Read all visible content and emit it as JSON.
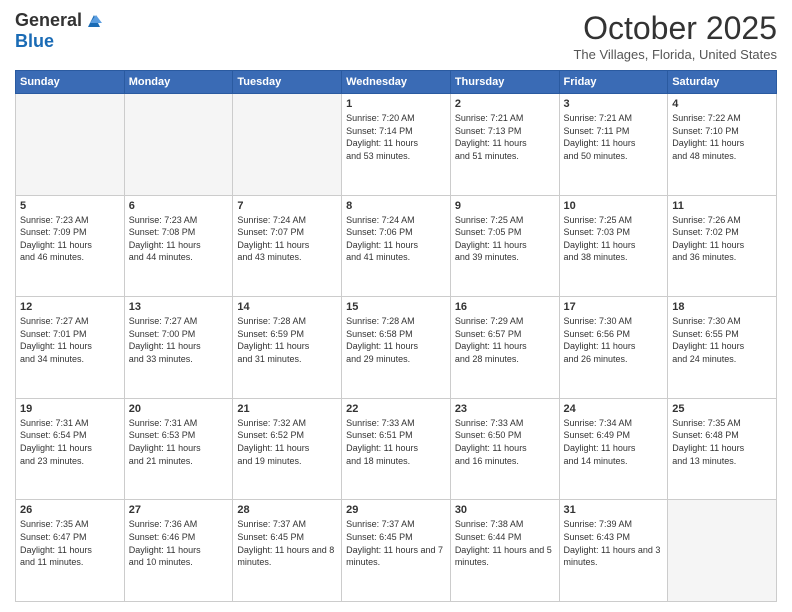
{
  "header": {
    "logo_general": "General",
    "logo_blue": "Blue",
    "month_title": "October 2025",
    "location": "The Villages, Florida, United States"
  },
  "weekdays": [
    "Sunday",
    "Monday",
    "Tuesday",
    "Wednesday",
    "Thursday",
    "Friday",
    "Saturday"
  ],
  "weeks": [
    [
      {
        "day": "",
        "empty": true
      },
      {
        "day": "",
        "empty": true
      },
      {
        "day": "",
        "empty": true
      },
      {
        "day": "1",
        "sunrise": "7:20 AM",
        "sunset": "7:14 PM",
        "daylight": "11 hours and 53 minutes."
      },
      {
        "day": "2",
        "sunrise": "7:21 AM",
        "sunset": "7:13 PM",
        "daylight": "11 hours and 51 minutes."
      },
      {
        "day": "3",
        "sunrise": "7:21 AM",
        "sunset": "7:11 PM",
        "daylight": "11 hours and 50 minutes."
      },
      {
        "day": "4",
        "sunrise": "7:22 AM",
        "sunset": "7:10 PM",
        "daylight": "11 hours and 48 minutes."
      }
    ],
    [
      {
        "day": "5",
        "sunrise": "7:23 AM",
        "sunset": "7:09 PM",
        "daylight": "11 hours and 46 minutes."
      },
      {
        "day": "6",
        "sunrise": "7:23 AM",
        "sunset": "7:08 PM",
        "daylight": "11 hours and 44 minutes."
      },
      {
        "day": "7",
        "sunrise": "7:24 AM",
        "sunset": "7:07 PM",
        "daylight": "11 hours and 43 minutes."
      },
      {
        "day": "8",
        "sunrise": "7:24 AM",
        "sunset": "7:06 PM",
        "daylight": "11 hours and 41 minutes."
      },
      {
        "day": "9",
        "sunrise": "7:25 AM",
        "sunset": "7:05 PM",
        "daylight": "11 hours and 39 minutes."
      },
      {
        "day": "10",
        "sunrise": "7:25 AM",
        "sunset": "7:03 PM",
        "daylight": "11 hours and 38 minutes."
      },
      {
        "day": "11",
        "sunrise": "7:26 AM",
        "sunset": "7:02 PM",
        "daylight": "11 hours and 36 minutes."
      }
    ],
    [
      {
        "day": "12",
        "sunrise": "7:27 AM",
        "sunset": "7:01 PM",
        "daylight": "11 hours and 34 minutes."
      },
      {
        "day": "13",
        "sunrise": "7:27 AM",
        "sunset": "7:00 PM",
        "daylight": "11 hours and 33 minutes."
      },
      {
        "day": "14",
        "sunrise": "7:28 AM",
        "sunset": "6:59 PM",
        "daylight": "11 hours and 31 minutes."
      },
      {
        "day": "15",
        "sunrise": "7:28 AM",
        "sunset": "6:58 PM",
        "daylight": "11 hours and 29 minutes."
      },
      {
        "day": "16",
        "sunrise": "7:29 AM",
        "sunset": "6:57 PM",
        "daylight": "11 hours and 28 minutes."
      },
      {
        "day": "17",
        "sunrise": "7:30 AM",
        "sunset": "6:56 PM",
        "daylight": "11 hours and 26 minutes."
      },
      {
        "day": "18",
        "sunrise": "7:30 AM",
        "sunset": "6:55 PM",
        "daylight": "11 hours and 24 minutes."
      }
    ],
    [
      {
        "day": "19",
        "sunrise": "7:31 AM",
        "sunset": "6:54 PM",
        "daylight": "11 hours and 23 minutes."
      },
      {
        "day": "20",
        "sunrise": "7:31 AM",
        "sunset": "6:53 PM",
        "daylight": "11 hours and 21 minutes."
      },
      {
        "day": "21",
        "sunrise": "7:32 AM",
        "sunset": "6:52 PM",
        "daylight": "11 hours and 19 minutes."
      },
      {
        "day": "22",
        "sunrise": "7:33 AM",
        "sunset": "6:51 PM",
        "daylight": "11 hours and 18 minutes."
      },
      {
        "day": "23",
        "sunrise": "7:33 AM",
        "sunset": "6:50 PM",
        "daylight": "11 hours and 16 minutes."
      },
      {
        "day": "24",
        "sunrise": "7:34 AM",
        "sunset": "6:49 PM",
        "daylight": "11 hours and 14 minutes."
      },
      {
        "day": "25",
        "sunrise": "7:35 AM",
        "sunset": "6:48 PM",
        "daylight": "11 hours and 13 minutes."
      }
    ],
    [
      {
        "day": "26",
        "sunrise": "7:35 AM",
        "sunset": "6:47 PM",
        "daylight": "11 hours and 11 minutes."
      },
      {
        "day": "27",
        "sunrise": "7:36 AM",
        "sunset": "6:46 PM",
        "daylight": "11 hours and 10 minutes."
      },
      {
        "day": "28",
        "sunrise": "7:37 AM",
        "sunset": "6:45 PM",
        "daylight": "11 hours and 8 minutes."
      },
      {
        "day": "29",
        "sunrise": "7:37 AM",
        "sunset": "6:45 PM",
        "daylight": "11 hours and 7 minutes."
      },
      {
        "day": "30",
        "sunrise": "7:38 AM",
        "sunset": "6:44 PM",
        "daylight": "11 hours and 5 minutes."
      },
      {
        "day": "31",
        "sunrise": "7:39 AM",
        "sunset": "6:43 PM",
        "daylight": "11 hours and 3 minutes."
      },
      {
        "day": "",
        "empty": true
      }
    ]
  ],
  "labels": {
    "sunrise": "Sunrise:",
    "sunset": "Sunset:",
    "daylight": "Daylight:"
  }
}
